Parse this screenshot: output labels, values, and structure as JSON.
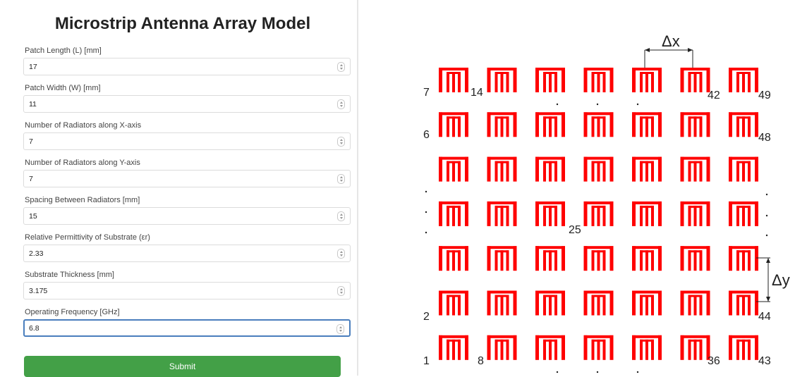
{
  "form": {
    "title": "Microstrip Antenna Array Model",
    "fields": [
      {
        "label": "Patch Length (L) [mm]",
        "value": "17"
      },
      {
        "label": "Patch Width (W) [mm]",
        "value": "11"
      },
      {
        "label": "Number of Radiators along X-axis",
        "value": "7"
      },
      {
        "label": "Number of Radiators along Y-axis",
        "value": "7"
      },
      {
        "label": "Spacing Between Radiators [mm]",
        "value": "15"
      },
      {
        "label": "Relative Permittivity of Substrate (εr)",
        "value": "2.33"
      },
      {
        "label": "Substrate Thickness [mm]",
        "value": "3.175"
      },
      {
        "label": "Operating Frequency [GHz]",
        "value": "6.8"
      }
    ],
    "submit_label": "Submit"
  },
  "figure": {
    "element_color": "#ff0000",
    "dx_label": "Δx",
    "dy_label": "Δy",
    "grid_rows": 7,
    "grid_cols": 7,
    "element_numbers": [
      "1",
      "2",
      "6",
      "7",
      "8",
      "14",
      "25",
      "36",
      "42",
      "43",
      "44",
      "48",
      "49"
    ]
  }
}
